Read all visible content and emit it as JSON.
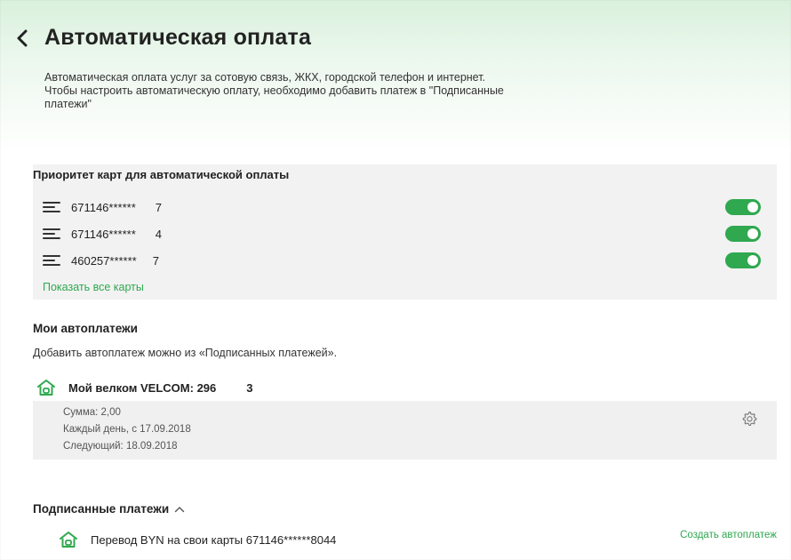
{
  "header": {
    "back_icon": "chevron-left-icon",
    "title": "Автоматическая оплата",
    "description": "Автоматическая оплата услуг за сотовую связь, ЖКХ, городской телефон и интернет. Чтобы настроить автоматическую оплату, необходимо добавить платеж в \"Подписанные платежи\""
  },
  "priority": {
    "title": "Приоритет карт для автоматической оплаты",
    "cards": [
      {
        "number": "671146******",
        "suffix": "7",
        "enabled": true
      },
      {
        "number": "671146******",
        "suffix": "4",
        "enabled": true
      },
      {
        "number": "460257******",
        "suffix": "7",
        "enabled": true
      }
    ],
    "show_all": "Показать все карты"
  },
  "autopayments": {
    "title": "Мои автоплатежи",
    "hint": "Добавить автоплатеж можно из «Подписанных платежей».",
    "items": [
      {
        "name": "Мой велком  VELCOM:  296",
        "suffix": "3",
        "sum": "Сумма: 2,00",
        "schedule": "Каждый день, с 17.09.2018",
        "next": "Следующий: 18.09.2018"
      }
    ]
  },
  "signed": {
    "title": "Подписанные платежи",
    "items": [
      {
        "name": "Перевод BYN на свои карты  671146******8044",
        "action": "Создать автоплатеж"
      }
    ]
  },
  "colors": {
    "accent": "#2fa84f",
    "panel": "#f2f2f2",
    "header_tint": "#d9f1dc"
  }
}
